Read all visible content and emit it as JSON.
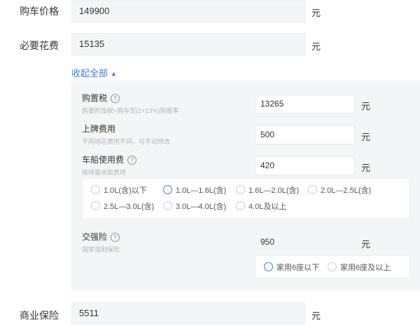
{
  "car_price": {
    "label": "购车价格",
    "value": "149900",
    "unit": "元"
  },
  "necessary_cost": {
    "label": "必要花费",
    "value": "15135",
    "unit": "元"
  },
  "collapse_toggle": {
    "label": "收起全部",
    "arrow": "▲"
  },
  "purchase_tax": {
    "label": "购置税",
    "hint": "购置附加税=购车型(1+13%)购置率",
    "value": "13265",
    "unit": "元",
    "help": "?"
  },
  "license_fee": {
    "label": "上牌费用",
    "hint": "不同地区费用不同，可手动修改",
    "value": "500",
    "unit": "元"
  },
  "vessel_tax": {
    "label": "车船使用费",
    "hint": "按排量收取费用",
    "value": "420",
    "unit": "元",
    "help": "?",
    "options": [
      {
        "label": "1.0L(含)以下",
        "selected": false
      },
      {
        "label": "1.0L—1.6L(含)",
        "selected": true
      },
      {
        "label": "1.6L—2.0L(含)",
        "selected": false
      },
      {
        "label": "2.0L—2.5L(含)",
        "selected": false
      },
      {
        "label": "2.5L—3.0L(含)",
        "selected": false
      },
      {
        "label": "3.0L—4.0L(含)",
        "selected": false
      },
      {
        "label": "4.0L及以上",
        "selected": false
      }
    ]
  },
  "compulsory_insurance": {
    "label": "交强险",
    "hint": "国家强制保险",
    "value": "950",
    "unit": "元",
    "help": "?",
    "options": [
      {
        "label": "家用6座以下",
        "selected": true
      },
      {
        "label": "家用6座及以上",
        "selected": false
      }
    ]
  },
  "commercial_insurance": {
    "label": "商业保险",
    "value": "5511",
    "unit": "元"
  },
  "colors": {
    "accent": "#3b7ce0",
    "panel_bg": "#f4f5f7",
    "input_bg": "#f4f5f7"
  }
}
